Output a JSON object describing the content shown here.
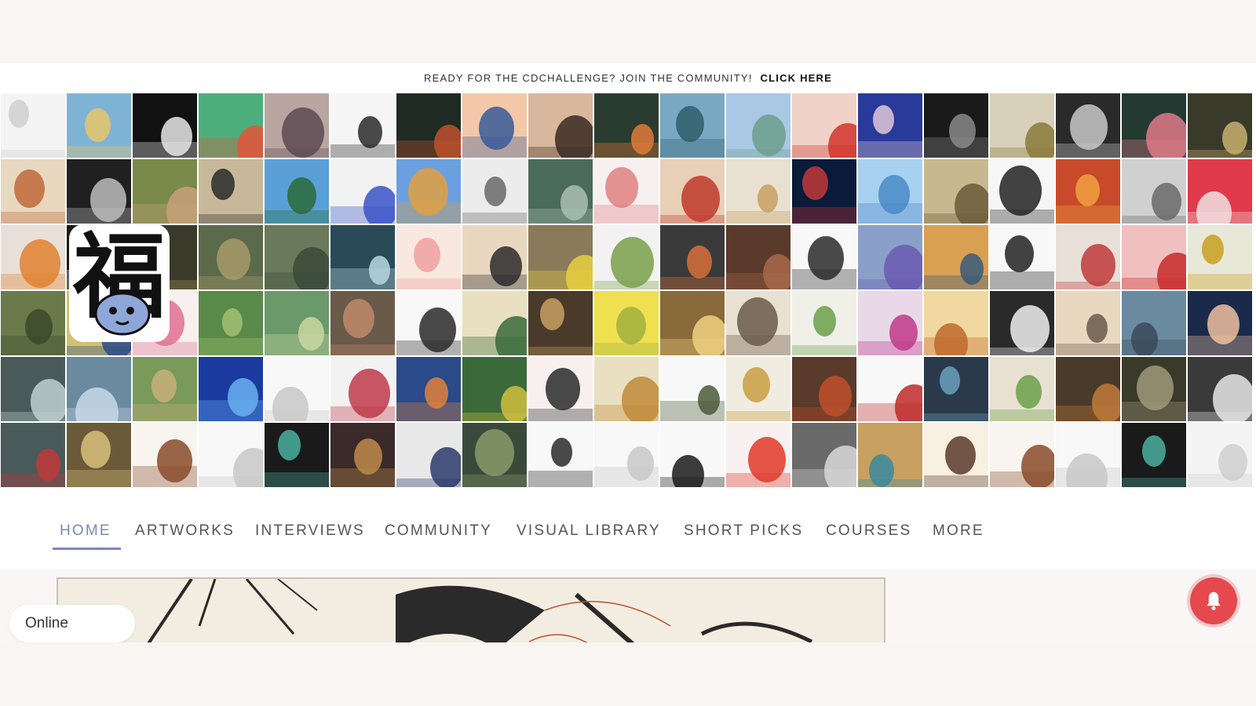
{
  "banner": {
    "message": "READY FOR THE CDCHALLENGE? JOIN THE COMMUNITY!",
    "cta": "CLICK HERE"
  },
  "sticker": {
    "glyph": "福"
  },
  "nav": {
    "items": [
      {
        "label": "HOME",
        "active": true
      },
      {
        "label": "ARTWORKS",
        "active": false
      },
      {
        "label": "INTERVIEWS",
        "active": false
      },
      {
        "label": "COMMUNITY",
        "active": false
      },
      {
        "label": "VISUAL LIBRARY",
        "active": false
      },
      {
        "label": "SHORT PICKS",
        "active": false
      },
      {
        "label": "COURSES",
        "active": false
      },
      {
        "label": "MORE",
        "active": false
      }
    ],
    "accent_color": "#7d87b8"
  },
  "chat": {
    "status": "Online"
  },
  "notification": {
    "icon": "bell-icon",
    "color": "#e5484d"
  },
  "mosaic": {
    "palettes": [
      [
        "#f4f4f4",
        "#cfcfcf"
      ],
      [
        "#7fb3d5",
        "#e8c66a"
      ],
      [
        "#111111",
        "#e8e8e8"
      ],
      [
        "#4caf7d",
        "#e2553a"
      ],
      [
        "#b9a6a0",
        "#5b4a52"
      ],
      [
        "#f5f5f5",
        "#2a2a2a"
      ],
      [
        "#1e2b22",
        "#c0502a"
      ],
      [
        "#f2c8a8",
        "#3a5a9a"
      ],
      [
        "#d9b79c",
        "#3a2a22"
      ],
      [
        "#2a3b2f",
        "#e07a3a"
      ],
      [
        "#7aa9c4",
        "#2f5f6a"
      ],
      [
        "#a8c8e6",
        "#6f9e8a"
      ],
      [
        "#f0d2c8",
        "#d2342a"
      ],
      [
        "#2a3a9a",
        "#e0c8d8"
      ],
      [
        "#1a1a1a",
        "#8a8a8a"
      ],
      [
        "#d8d0b8",
        "#8a7a3a"
      ],
      [
        "#2a2a2a",
        "#c8c8c8"
      ],
      [
        "#223a32",
        "#e07a8a"
      ],
      [
        "#3a3a2a",
        "#c8b070"
      ],
      [
        "#e8d8c0",
        "#c06a3a"
      ],
      [
        "#202020",
        "#bdbdbd"
      ],
      [
        "#7a8a4a",
        "#c8a07a"
      ],
      [
        "#c8b89a",
        "#2a2a2a"
      ],
      [
        "#5aa0d8",
        "#2a6a3a"
      ],
      [
        "#f2f2f2",
        "#3a52c8"
      ],
      [
        "#6aa0e0",
        "#e0a040"
      ],
      [
        "#ececec",
        "#6a6a6a"
      ],
      [
        "#4a6a5a",
        "#a8c0b0"
      ],
      [
        "#f8f0f0",
        "#e08080"
      ],
      [
        "#e8d0b8",
        "#c03a2a"
      ],
      [
        "#e8e0d0",
        "#c8a060"
      ],
      [
        "#0a1a3a",
        "#c03a3a"
      ],
      [
        "#a8d0f0",
        "#4a8ac8"
      ],
      [
        "#c8b890",
        "#6a5a3a"
      ],
      [
        "#f6f6f6",
        "#222222"
      ],
      [
        "#c84a2a",
        "#f0a040"
      ],
      [
        "#d0d0d0",
        "#6a6a6a"
      ],
      [
        "#e03a4a",
        "#f0e0e0"
      ],
      [
        "#e8e0d8",
        "#e08030"
      ],
      [
        "#1a1a1a",
        "#f2f2f2"
      ],
      [
        "#3a3a2a",
        "#a0905a"
      ],
      [
        "#5a6a4a",
        "#a89a6a"
      ],
      [
        "#6a7a5a",
        "#3a4a3a"
      ],
      [
        "#2a4a5a",
        "#b8d8e0"
      ],
      [
        "#f8e8e0",
        "#f0a0a0"
      ],
      [
        "#e8d8c0",
        "#2a2a2a"
      ],
      [
        "#8a7a5a",
        "#e8d040"
      ],
      [
        "#f2f2f2",
        "#7aa04a"
      ],
      [
        "#3a3a3a",
        "#d8703a"
      ],
      [
        "#5a3a2a",
        "#a86a4a"
      ],
      [
        "#f8f8f8",
        "#2a2a2a"
      ],
      [
        "#8aa0c8",
        "#6a5ab0"
      ],
      [
        "#d8a050",
        "#3a5a7a"
      ],
      [
        "#f8f8f8",
        "#222222"
      ],
      [
        "#e8e0d8",
        "#c03a3a"
      ],
      [
        "#f0c0c0",
        "#c82a2a"
      ],
      [
        "#e8e8d8",
        "#c8a020"
      ],
      [
        "#6a7a4a",
        "#3a4a2a"
      ],
      [
        "#d0c070",
        "#2a4a8a"
      ],
      [
        "#f8f0f0",
        "#e07090"
      ],
      [
        "#5a8a4a",
        "#a0c070"
      ],
      [
        "#6a9a6a",
        "#c8d8a0"
      ],
      [
        "#6a5a4a",
        "#c08a6a"
      ],
      [
        "#f8f8f8",
        "#2a2a2a"
      ],
      [
        "#e8e0c0",
        "#3a6a3a"
      ],
      [
        "#4a3a2a",
        "#c8a060"
      ],
      [
        "#f0e050",
        "#a0b040"
      ],
      [
        "#8a6a3a",
        "#f0d080"
      ],
      [
        "#e8e0d0",
        "#6a5a4a"
      ],
      [
        "#f0f0e8",
        "#6aa04a"
      ],
      [
        "#e8d8e8",
        "#c03a8a"
      ],
      [
        "#f0d8a0",
        "#c06a2a"
      ],
      [
        "#2a2a2a",
        "#f0f0f0"
      ],
      [
        "#e8d8c0",
        "#6a5a4a"
      ],
      [
        "#6a8aa0",
        "#3a4a5a"
      ],
      [
        "#1a2a4a",
        "#f0c0a0"
      ],
      [
        "#4a5a5a",
        "#c0d0d0"
      ],
      [
        "#6a8aa0",
        "#c8d8e8"
      ],
      [
        "#7a9a5a",
        "#c8b07a"
      ],
      [
        "#1a3aa0",
        "#6ab0f0"
      ],
      [
        "#f8f8f8",
        "#c8c8c8"
      ],
      [
        "#f2f2f2",
        "#c03a4a"
      ],
      [
        "#2a4a8a",
        "#e0803a"
      ],
      [
        "#3a6a3a",
        "#d0c040"
      ],
      [
        "#f8f0f0",
        "#2a2a2a"
      ],
      [
        "#e8e0c0",
        "#c08a3a"
      ],
      [
        "#f8f8f8",
        "#4a5a3a"
      ],
      [
        "#f0ece0",
        "#c8a040"
      ],
      [
        "#5a3a2a",
        "#c0502a"
      ],
      [
        "#f8f8f8",
        "#c02a2a"
      ],
      [
        "#2a3a4a",
        "#6aa0c0"
      ],
      [
        "#e8e0d0",
        "#6aa04a"
      ],
      [
        "#4a3a2a",
        "#c07a3a"
      ],
      [
        "#3a3a2a",
        "#a09a7a"
      ],
      [
        "#3a3a3a",
        "#e8e8e8"
      ],
      [
        "#4a5a5a",
        "#c03a3a"
      ],
      [
        "#6a5a3a",
        "#d8c07a"
      ],
      [
        "#f8f4f0",
        "#8a4a2a"
      ],
      [
        "#f8f8f8",
        "#c8c8c8"
      ],
      [
        "#1a1a1a",
        "#4ab0a0"
      ],
      [
        "#3a2a2a",
        "#c08a4a"
      ],
      [
        "#e8e8e8",
        "#2a3a6a"
      ],
      [
        "#3a4a3a",
        "#8a9a6a"
      ],
      [
        "#f8f8f8",
        "#2a2a2a"
      ],
      [
        "#f8f8f8",
        "#c8c8c8"
      ],
      [
        "#f8f8f8",
        "#1a1a1a"
      ],
      [
        "#f8f0f0",
        "#e03a2a"
      ],
      [
        "#6a6a6a",
        "#d8d8d8"
      ],
      [
        "#c8a060",
        "#3a8aa0"
      ],
      [
        "#f8f0e0",
        "#5a3a2a"
      ],
      [
        "#f8f4f0",
        "#8a4a2a"
      ],
      [
        "#f8f8f8",
        "#c8c8c8"
      ],
      [
        "#1a1a1a",
        "#4ab0a0"
      ]
    ]
  }
}
